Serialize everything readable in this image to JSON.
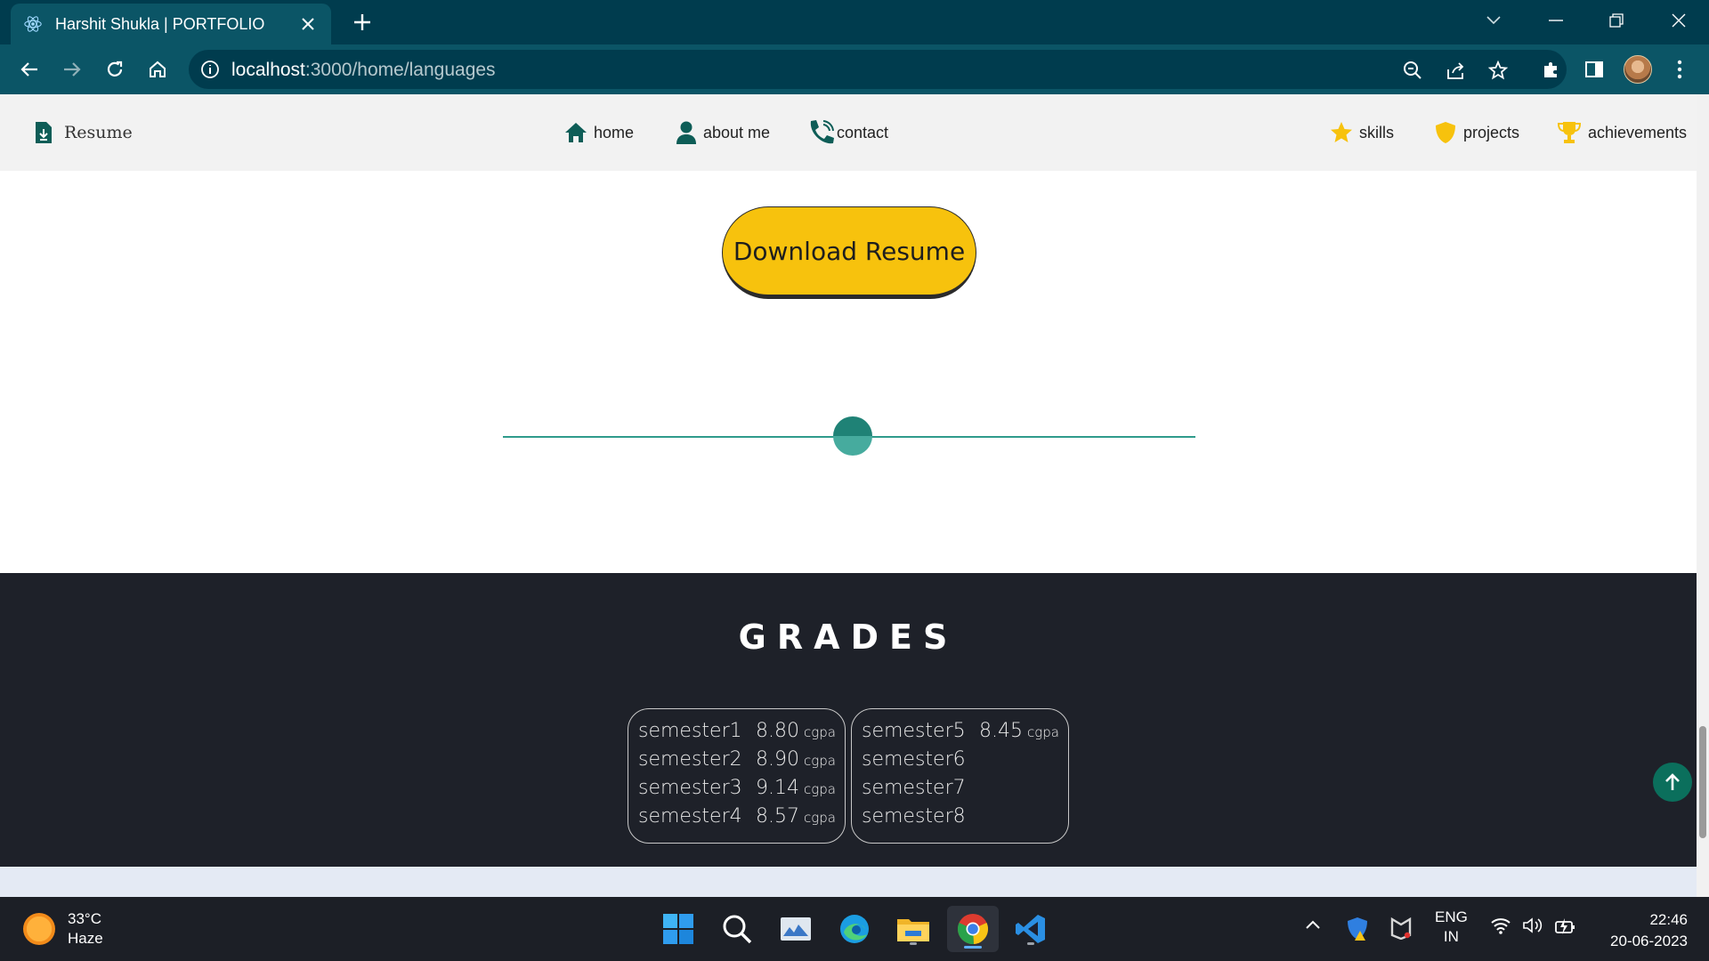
{
  "browser": {
    "tab_title": "Harshit Shukla | PORTFOLIO",
    "url_host": "localhost",
    "url_path": ":3000/home/languages"
  },
  "navbar": {
    "resume_label": "Resume",
    "center": [
      {
        "label": "home",
        "icon": "home-icon"
      },
      {
        "label": "about me",
        "icon": "user-icon"
      },
      {
        "label": "contact",
        "icon": "phone-icon"
      }
    ],
    "right": [
      {
        "label": "skills",
        "icon": "star-icon"
      },
      {
        "label": "projects",
        "icon": "shield-icon"
      },
      {
        "label": "achievements",
        "icon": "trophy-icon"
      }
    ]
  },
  "main": {
    "download_label": "Download Resume",
    "slider_value": 0.5
  },
  "grades": {
    "title": "GRADES",
    "unit": "cgpa",
    "left": [
      {
        "sem": "semester1",
        "val": "8.80"
      },
      {
        "sem": "semester2",
        "val": "8.90"
      },
      {
        "sem": "semester3",
        "val": "9.14"
      },
      {
        "sem": "semester4",
        "val": "8.57"
      }
    ],
    "right": [
      {
        "sem": "semester5",
        "val": "8.45"
      },
      {
        "sem": "semester6",
        "val": ""
      },
      {
        "sem": "semester7",
        "val": ""
      },
      {
        "sem": "semester8",
        "val": ""
      }
    ]
  },
  "taskbar": {
    "temp": "33°C",
    "condition": "Haze",
    "lang1": "ENG",
    "lang2": "IN",
    "time": "22:46",
    "date": "20-06-2023"
  },
  "colors": {
    "browser_dark": "#003c4e",
    "browser_toolbar": "#0b5566",
    "accent_yellow": "#f7c20d",
    "teal": "#2f9b8c",
    "grades_bg": "#1e2129"
  }
}
